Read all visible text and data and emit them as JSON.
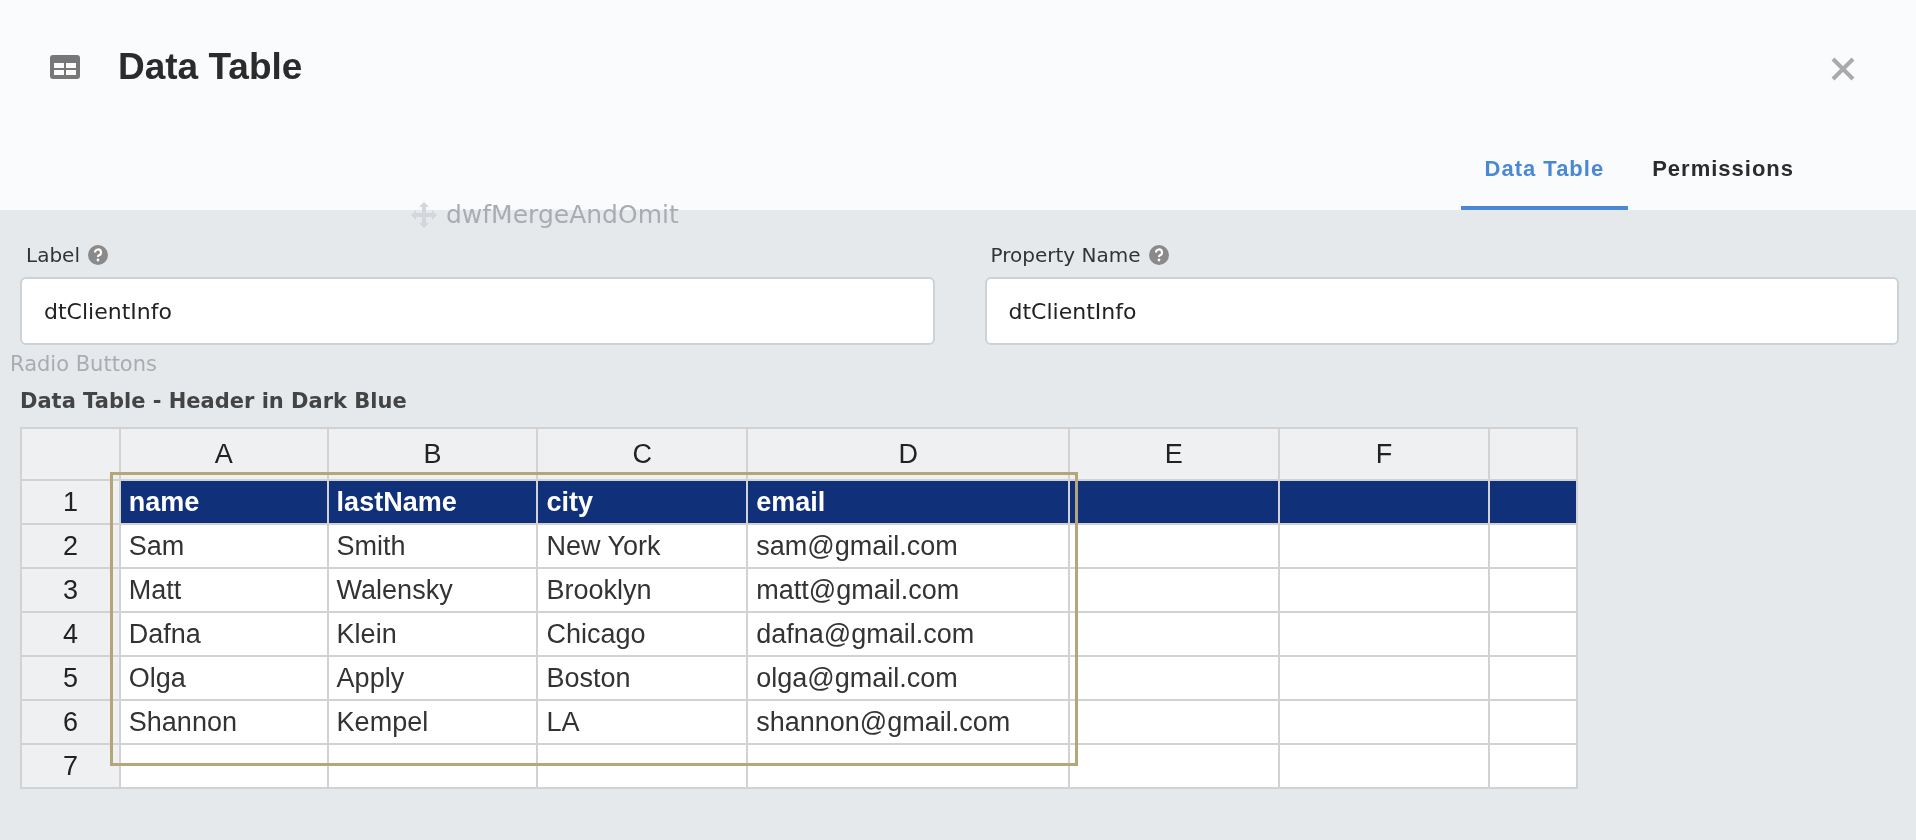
{
  "dialog": {
    "title": "Data Table",
    "tabs": [
      {
        "label": "Data Table",
        "selected": true
      },
      {
        "label": "Permissions",
        "selected": false
      }
    ]
  },
  "background": {
    "texts": [
      "dwfMergeAndOmit",
      "Radio Buttons"
    ]
  },
  "fields": [
    {
      "label": "Label",
      "value": "dtClientInfo"
    },
    {
      "label": "Property Name",
      "value": "dtClientInfo"
    }
  ],
  "table": {
    "title": "Data Table - Header in Dark Blue",
    "columns": [
      "A",
      "B",
      "C",
      "D",
      "E",
      "F"
    ],
    "rows": [
      {
        "number": "1",
        "kind": "header",
        "cells": [
          "name",
          "lastName",
          "city",
          "email"
        ]
      },
      {
        "number": "2",
        "kind": "data",
        "cells": [
          "Sam",
          "Smith",
          "New York",
          "sam@gmail.com"
        ]
      },
      {
        "number": "3",
        "kind": "data",
        "cells": [
          "Matt",
          "Walensky",
          "Brooklyn",
          "matt@gmail.com"
        ]
      },
      {
        "number": "4",
        "kind": "data",
        "cells": [
          "Dafna",
          "Klein",
          "Chicago",
          "dafna@gmail.com"
        ]
      },
      {
        "number": "5",
        "kind": "data",
        "cells": [
          "Olga",
          "Apply",
          "Boston",
          "olga@gmail.com"
        ]
      },
      {
        "number": "6",
        "kind": "data",
        "cells": [
          "Shannon",
          "Kempel",
          "LA",
          "shannon@gmail.com"
        ]
      },
      {
        "number": "7",
        "kind": "data",
        "cells": []
      }
    ]
  }
}
